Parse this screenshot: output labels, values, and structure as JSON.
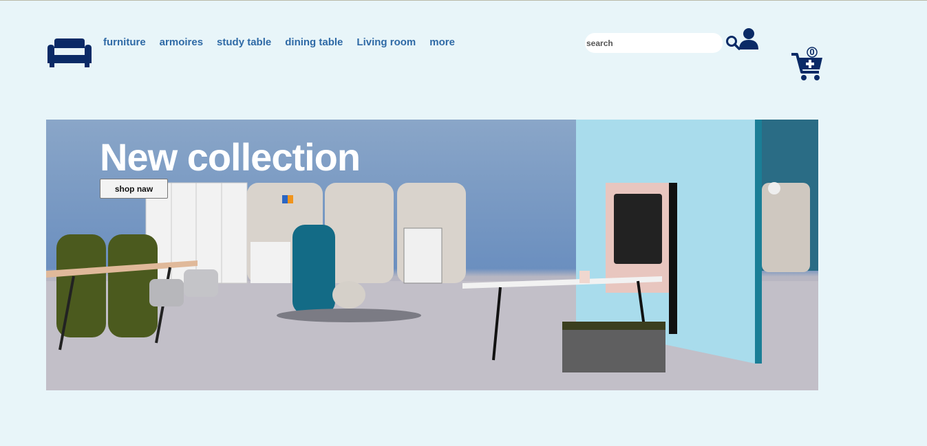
{
  "brand": {
    "logo_icon": "sofa-icon",
    "color": "#0a2a66"
  },
  "nav": {
    "items": [
      {
        "label": "furniture"
      },
      {
        "label": "armoires"
      },
      {
        "label": "study table"
      },
      {
        "label": "dining table"
      },
      {
        "label": "Living room"
      },
      {
        "label": "more"
      }
    ],
    "link_color": "#2f6aa6"
  },
  "search": {
    "placeholder": "search",
    "value": "",
    "icon": "search-icon"
  },
  "account": {
    "icon": "user-icon"
  },
  "cart": {
    "icon": "cart-add-icon",
    "count": "0"
  },
  "hero": {
    "title": "New collection",
    "button_label": "shop naw",
    "image": "office furniture collection photo"
  },
  "colors": {
    "background": "#e8f5f9",
    "accent": "#0a2a66"
  }
}
